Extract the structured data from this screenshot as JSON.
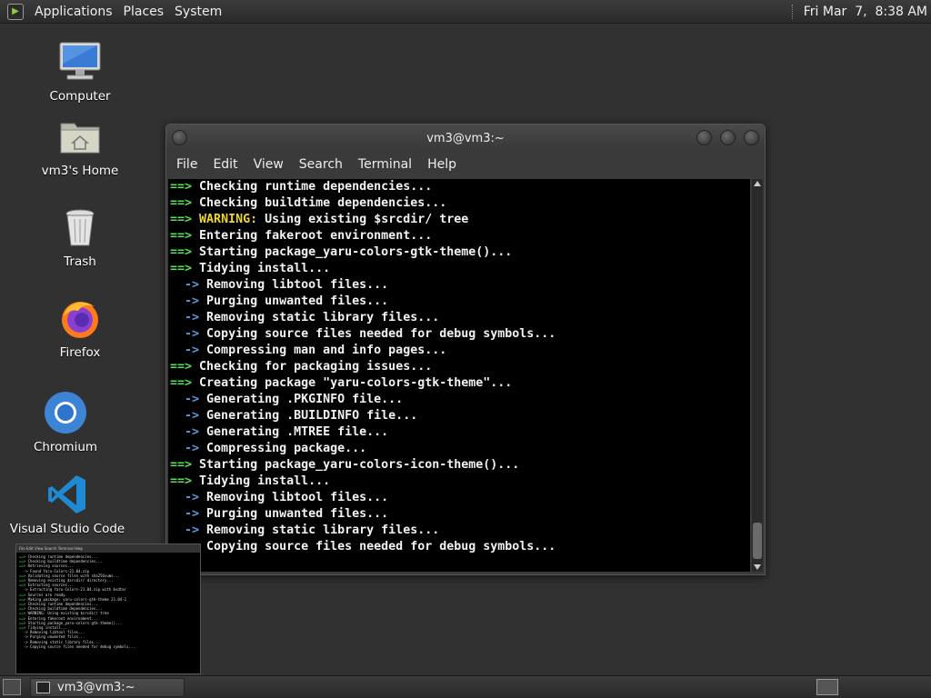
{
  "top_panel": {
    "menus": [
      "Applications",
      "Places",
      "System"
    ],
    "clock": "Fri Mar  7,  8:38 AM"
  },
  "desktop_icons": [
    {
      "label": "Computer",
      "icon": "computer-icon"
    },
    {
      "label": "vm3's Home",
      "icon": "home-folder-icon"
    },
    {
      "label": "Trash",
      "icon": "trash-icon"
    },
    {
      "label": "Firefox",
      "icon": "firefox-icon"
    },
    {
      "label": "Chromium",
      "icon": "chromium-icon"
    },
    {
      "label": "Visual Studio Code",
      "icon": "vscode-icon"
    }
  ],
  "terminal": {
    "title": "vm3@vm3:~",
    "menus": [
      "File",
      "Edit",
      "View",
      "Search",
      "Terminal",
      "Help"
    ],
    "lines": [
      {
        "prefix": "==>",
        "kind": "main",
        "text": "Checking runtime dependencies..."
      },
      {
        "prefix": "==>",
        "kind": "main",
        "text": "Checking buildtime dependencies..."
      },
      {
        "prefix": "==>",
        "kind": "warn",
        "warn": "WARNING:",
        "text": "Using existing $srcdir/ tree"
      },
      {
        "prefix": "==>",
        "kind": "main",
        "text": "Entering fakeroot environment..."
      },
      {
        "prefix": "==>",
        "kind": "main",
        "text": "Starting package_yaru-colors-gtk-theme()..."
      },
      {
        "prefix": "==>",
        "kind": "main",
        "text": "Tidying install..."
      },
      {
        "prefix": "->",
        "kind": "sub",
        "text": "Removing libtool files..."
      },
      {
        "prefix": "->",
        "kind": "sub",
        "text": "Purging unwanted files..."
      },
      {
        "prefix": "->",
        "kind": "sub",
        "text": "Removing static library files..."
      },
      {
        "prefix": "->",
        "kind": "sub",
        "text": "Copying source files needed for debug symbols..."
      },
      {
        "prefix": "->",
        "kind": "sub",
        "text": "Compressing man and info pages..."
      },
      {
        "prefix": "==>",
        "kind": "main",
        "text": "Checking for packaging issues..."
      },
      {
        "prefix": "==>",
        "kind": "main",
        "text": "Creating package \"yaru-colors-gtk-theme\"..."
      },
      {
        "prefix": "->",
        "kind": "sub",
        "text": "Generating .PKGINFO file..."
      },
      {
        "prefix": "->",
        "kind": "sub",
        "text": "Generating .BUILDINFO file..."
      },
      {
        "prefix": "->",
        "kind": "sub",
        "text": "Generating .MTREE file..."
      },
      {
        "prefix": "->",
        "kind": "sub",
        "text": "Compressing package..."
      },
      {
        "prefix": "==>",
        "kind": "main",
        "text": "Starting package_yaru-colors-icon-theme()..."
      },
      {
        "prefix": "==>",
        "kind": "main",
        "text": "Tidying install..."
      },
      {
        "prefix": "->",
        "kind": "sub",
        "text": "Removing libtool files..."
      },
      {
        "prefix": "->",
        "kind": "sub",
        "text": "Purging unwanted files..."
      },
      {
        "prefix": "->",
        "kind": "sub",
        "text": "Removing static library files..."
      },
      {
        "prefix": "",
        "kind": "sub",
        "text": "Copying source files needed for debug symbols..."
      }
    ]
  },
  "taskbar": {
    "task_label": "vm3@vm3:~"
  },
  "colors": {
    "prefix_main": "#55e055",
    "prefix_sub": "#5d9bd8",
    "warning": "#f0d430"
  }
}
